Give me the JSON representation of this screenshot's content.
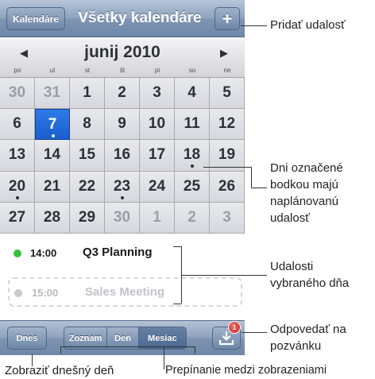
{
  "nav": {
    "calendars_label": "Kalendáre",
    "title": "Všetky kalendáre",
    "add_label": "+"
  },
  "month": {
    "title": "junij 2010",
    "weekdays": [
      "po",
      "ut",
      "st",
      "št",
      "pi",
      "so",
      "ne"
    ]
  },
  "days": [
    {
      "n": "30",
      "dim": true
    },
    {
      "n": "31",
      "dim": true
    },
    {
      "n": "1"
    },
    {
      "n": "2"
    },
    {
      "n": "3"
    },
    {
      "n": "4"
    },
    {
      "n": "5"
    },
    {
      "n": "6"
    },
    {
      "n": "7",
      "today": true,
      "dot": true
    },
    {
      "n": "8"
    },
    {
      "n": "9"
    },
    {
      "n": "10"
    },
    {
      "n": "11"
    },
    {
      "n": "12"
    },
    {
      "n": "13"
    },
    {
      "n": "14"
    },
    {
      "n": "15"
    },
    {
      "n": "16"
    },
    {
      "n": "17"
    },
    {
      "n": "18",
      "dot": true
    },
    {
      "n": "19"
    },
    {
      "n": "20",
      "dot": true
    },
    {
      "n": "21"
    },
    {
      "n": "22"
    },
    {
      "n": "23",
      "dot": true
    },
    {
      "n": "24"
    },
    {
      "n": "25"
    },
    {
      "n": "26"
    },
    {
      "n": "27"
    },
    {
      "n": "28"
    },
    {
      "n": "29"
    },
    {
      "n": "30",
      "dim": true
    },
    {
      "n": "1",
      "dim": true
    },
    {
      "n": "2",
      "dim": true
    },
    {
      "n": "3",
      "dim": true
    }
  ],
  "events": [
    {
      "time": "14:00",
      "title": "Q3 Planning",
      "color": "#33c13b"
    },
    {
      "time": "15:00",
      "title": "Sales Meeting",
      "color": "#c7c9cd"
    }
  ],
  "toolbar": {
    "today_label": "Dnes",
    "views": [
      "Zoznam",
      "Deň",
      "Mesiac"
    ],
    "active_view": "Mesiac",
    "badge": "1"
  },
  "callouts": {
    "add_event": "Pridať udalosť",
    "dot_days": [
      "Dni označené",
      "bodkou majú",
      "naplánovanú",
      "udalosť"
    ],
    "day_events": [
      "Udalosti",
      "vybraného dňa"
    ],
    "respond": [
      "Odpovedať na",
      "pozvánku"
    ],
    "show_today": "Zobraziť dnešný deň",
    "switch_views": "Prepínanie medzi zobrazeniami"
  }
}
